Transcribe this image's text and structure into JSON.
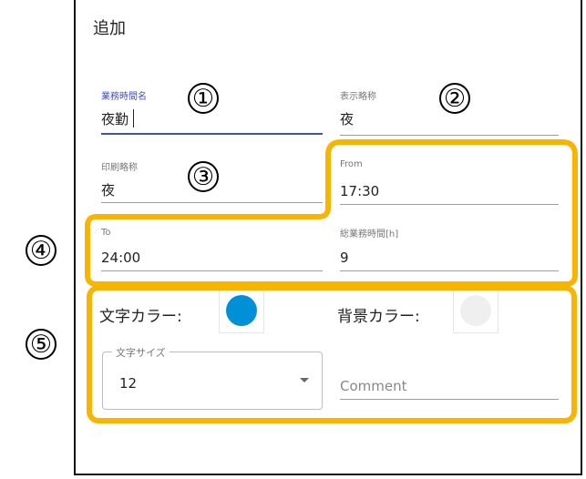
{
  "dialog": {
    "title": "追加"
  },
  "fields": {
    "business_time_name": {
      "label": "業務時間名",
      "value": "夜勤"
    },
    "display_abbrev": {
      "label": "表示略称",
      "value": "夜"
    },
    "print_abbrev": {
      "label": "印刷略称",
      "value": "夜"
    },
    "from": {
      "label": "From",
      "value": "17:30"
    },
    "to": {
      "label": "To",
      "value": "24:00"
    },
    "total_hours": {
      "label": "総業務時間[h]",
      "value": "9"
    }
  },
  "colors": {
    "text_color_label": "文字カラー:",
    "text_color": "#0090d8",
    "bg_color_label": "背景カラー:",
    "bg_color": "#efefef"
  },
  "font_size": {
    "legend": "文字サイズ",
    "value": "12"
  },
  "comment": {
    "placeholder": "Comment"
  },
  "callouts": [
    "①",
    "②",
    "③",
    "④",
    "⑤"
  ],
  "highlight_color": "#f7b500"
}
